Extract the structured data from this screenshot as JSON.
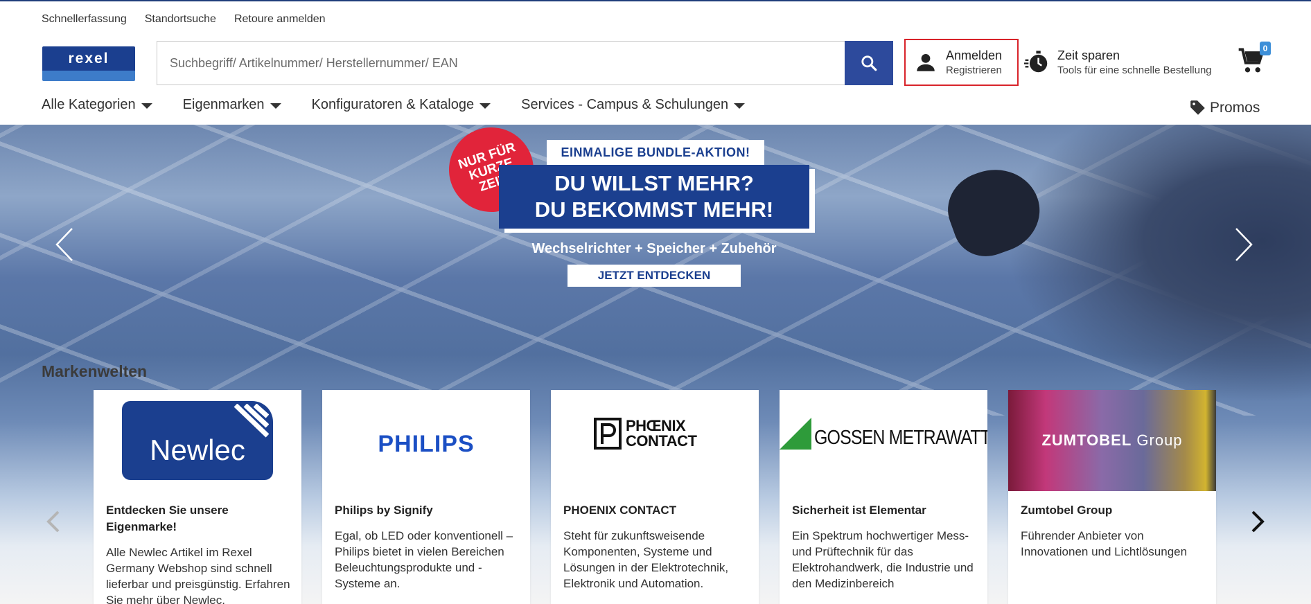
{
  "util_links": [
    "Schnellerfassung",
    "Standortsuche",
    "Retoure anmelden"
  ],
  "logo": {
    "text": "rexel"
  },
  "search": {
    "placeholder": "Suchbegriff/ Artikelnummer/ Herstellernummer/ EAN"
  },
  "account": {
    "login": "Anmelden",
    "register": "Registrieren"
  },
  "tools": {
    "title": "Zeit sparen",
    "subtitle": "Tools für eine schnelle Bestellung"
  },
  "cart": {
    "count": "0"
  },
  "nav": [
    "Alle Kategorien",
    "Eigenmarken",
    "Konfiguratoren & Kataloge",
    "Services - Campus & Schulungen"
  ],
  "promos": "Promos",
  "hero": {
    "badge": [
      "NUR FÜR",
      "KURZE",
      "ZEIT!"
    ],
    "bundle": "EINMALIGE BUNDLE-AKTION!",
    "headline": [
      "DU WILLST MEHR?",
      "DU BEKOMMST MEHR!"
    ],
    "sub": "Wechselrichter + Speicher + Zubehör",
    "cta": "JETZT ENTDECKEN"
  },
  "marken": {
    "title": "Markenwelten",
    "cards": [
      {
        "logo": "Newlec",
        "title": "Entdecken Sie unsere Eigenmarke!",
        "desc": "Alle Newlec Artikel im Rexel Germany Webshop sind schnell lieferbar und preisgünstig. Erfahren Sie mehr über Newlec."
      },
      {
        "logo": "PHILIPS",
        "title": "Philips by Signify",
        "desc": "Egal, ob LED oder konventionell – Philips bietet in vielen Bereichen Beleuchtungsprodukte und -Systeme an."
      },
      {
        "logo": "PHŒNIX CONTACT",
        "title": "PHOENIX CONTACT",
        "desc": "Steht für zukunftsweisende Komponenten, Systeme und Lösungen in der Elektrotechnik, Elektronik und Automation."
      },
      {
        "logo": "GOSSEN METRAWATT",
        "title": "Sicherheit ist Elementar",
        "desc": "Ein Spektrum hochwertiger Mess- und Prüftechnik für das Elektrohandwerk, die Industrie und den Medizinbereich"
      },
      {
        "logo_main": "ZUMTOBEL",
        "logo_sub": "Group",
        "title": "Zumtobel Group",
        "desc": "Führender Anbieter von Innovationen und Lichtlösungen"
      }
    ]
  },
  "colors": {
    "brand_blue": "#1b3f8f",
    "search_button": "#2d4a9c",
    "login_border": "#d8232a",
    "badge_red": "#e1243a",
    "cart_badge": "#3d8fd8"
  }
}
